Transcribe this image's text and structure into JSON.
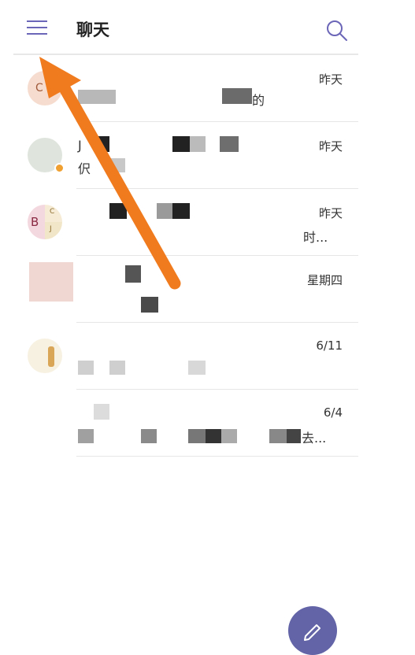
{
  "header": {
    "title": "聊天",
    "menu_icon": "hamburger-menu-icon",
    "search_icon": "search-icon"
  },
  "chats": [
    {
      "date": "昨天",
      "preview_visible": "的"
    },
    {
      "date": "昨天",
      "name_visible": "J",
      "preview_visible": "伬"
    },
    {
      "date": "昨天",
      "avatar_letter": "B",
      "avatar_sub": [
        "C",
        "J"
      ],
      "preview_visible": "时..."
    },
    {
      "date": "星期四"
    },
    {
      "date": "6/11"
    },
    {
      "date": "6/4",
      "preview_visible": "去..."
    }
  ],
  "fab": {
    "icon": "edit-icon"
  },
  "colors": {
    "accent": "#6264a7",
    "annotation_arrow": "#f07b1e"
  }
}
